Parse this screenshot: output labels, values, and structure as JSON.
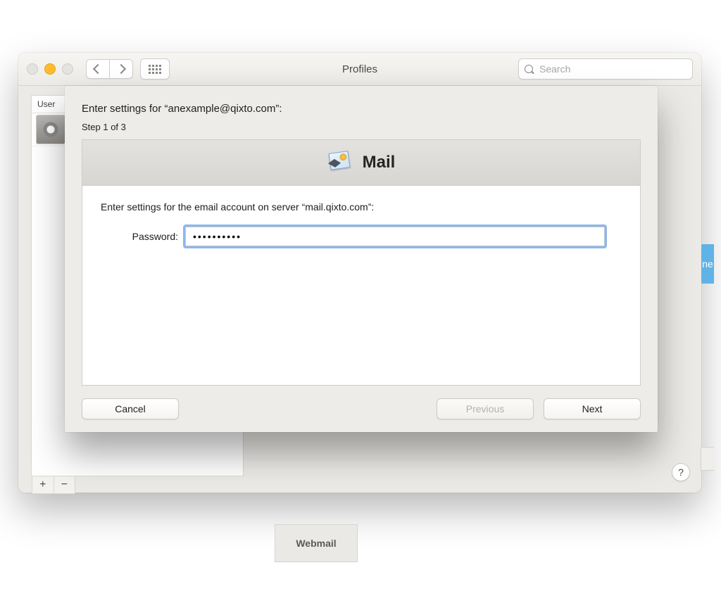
{
  "window": {
    "title": "Profiles",
    "search_placeholder": "Search",
    "sidebar": {
      "header": "User",
      "add_label": "+",
      "remove_label": "−"
    },
    "help_label": "?"
  },
  "sheet": {
    "heading": "Enter settings for “anexample@qixto.com”:",
    "step": "Step 1 of 3",
    "section_title": "Mail",
    "instruction": "Enter settings for the email account on server “mail.qixto.com”:",
    "password_label": "Password:",
    "password_value": "••••••••••",
    "cancel": "Cancel",
    "previous": "Previous",
    "next": "Next"
  },
  "background": {
    "webmail": "Webmail",
    "right_tab": "ne"
  }
}
